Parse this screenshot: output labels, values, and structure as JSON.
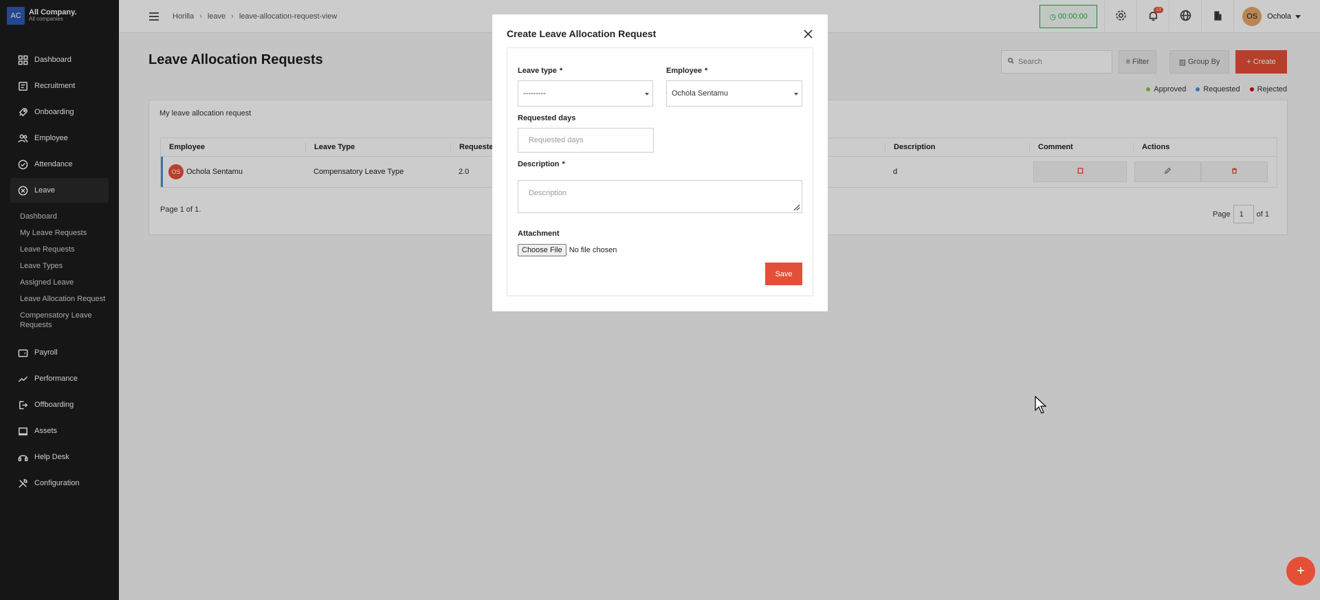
{
  "company": {
    "logo": "AC",
    "name": "All Company.",
    "sub": "All companies"
  },
  "sidebar": {
    "items": [
      {
        "label": "Dashboard",
        "icon": "dashboard-icon"
      },
      {
        "label": "Recruitment",
        "icon": "recruitment-icon"
      },
      {
        "label": "Onboarding",
        "icon": "rocket-icon"
      },
      {
        "label": "Employee",
        "icon": "users-icon"
      },
      {
        "label": "Attendance",
        "icon": "check-circle-icon"
      },
      {
        "label": "Leave",
        "icon": "leave-icon"
      }
    ],
    "leave_sub": [
      "Dashboard",
      "My Leave Requests",
      "Leave Requests",
      "Leave Types",
      "Assigned Leave",
      "Leave Allocation Request",
      "Compensatory Leave Requests"
    ],
    "items_after": [
      {
        "label": "Payroll",
        "icon": "wallet-icon"
      },
      {
        "label": "Performance",
        "icon": "trend-icon"
      },
      {
        "label": "Offboarding",
        "icon": "exit-icon"
      },
      {
        "label": "Assets",
        "icon": "laptop-icon"
      },
      {
        "label": "Help Desk",
        "icon": "headset-icon"
      },
      {
        "label": "Configuration",
        "icon": "wrench-icon"
      }
    ]
  },
  "header": {
    "breadcrumb": [
      "Horilla",
      "leave",
      "leave-allocation-request-view"
    ],
    "timer": "00:00:00",
    "notification_count": "13",
    "user_initials": "OS",
    "user_name": "Ochola"
  },
  "main": {
    "title": "Leave Allocation Requests",
    "search_placeholder": "Search",
    "filter_label": "Filter",
    "group_label": "Group By",
    "create_label": "+ Create",
    "legend": [
      {
        "label": "Approved",
        "color": "#8bc34a"
      },
      {
        "label": "Requested",
        "color": "#4a90d9"
      },
      {
        "label": "Rejected",
        "color": "#d0021b"
      }
    ],
    "card_title": "My leave allocation request",
    "columns": [
      "Employee",
      "Leave Type",
      "Requested",
      "Description",
      "Comment",
      "Actions"
    ],
    "row": {
      "initials": "OS",
      "employee": "Ochola Sentamu",
      "leave_type": "Compensatory Leave Type",
      "requested": "2.0",
      "description": "d"
    },
    "page_text": "Page 1 of 1.",
    "pager": {
      "prefix": "Page",
      "value": "1",
      "suffix": "of 1"
    }
  },
  "modal": {
    "title": "Create Leave Allocation Request",
    "leave_type_label": "Leave type",
    "leave_type_value": "---------",
    "employee_label": "Employee",
    "employee_value": "Ochola Sentamu",
    "requested_days_label": "Requested days",
    "requested_days_placeholder": "Requested days",
    "description_label": "Description",
    "description_placeholder": "Description",
    "attachment_label": "Attachment",
    "file_button": "Choose File",
    "file_status": "No file chosen",
    "save_label": "Save",
    "required_mark": "*"
  }
}
